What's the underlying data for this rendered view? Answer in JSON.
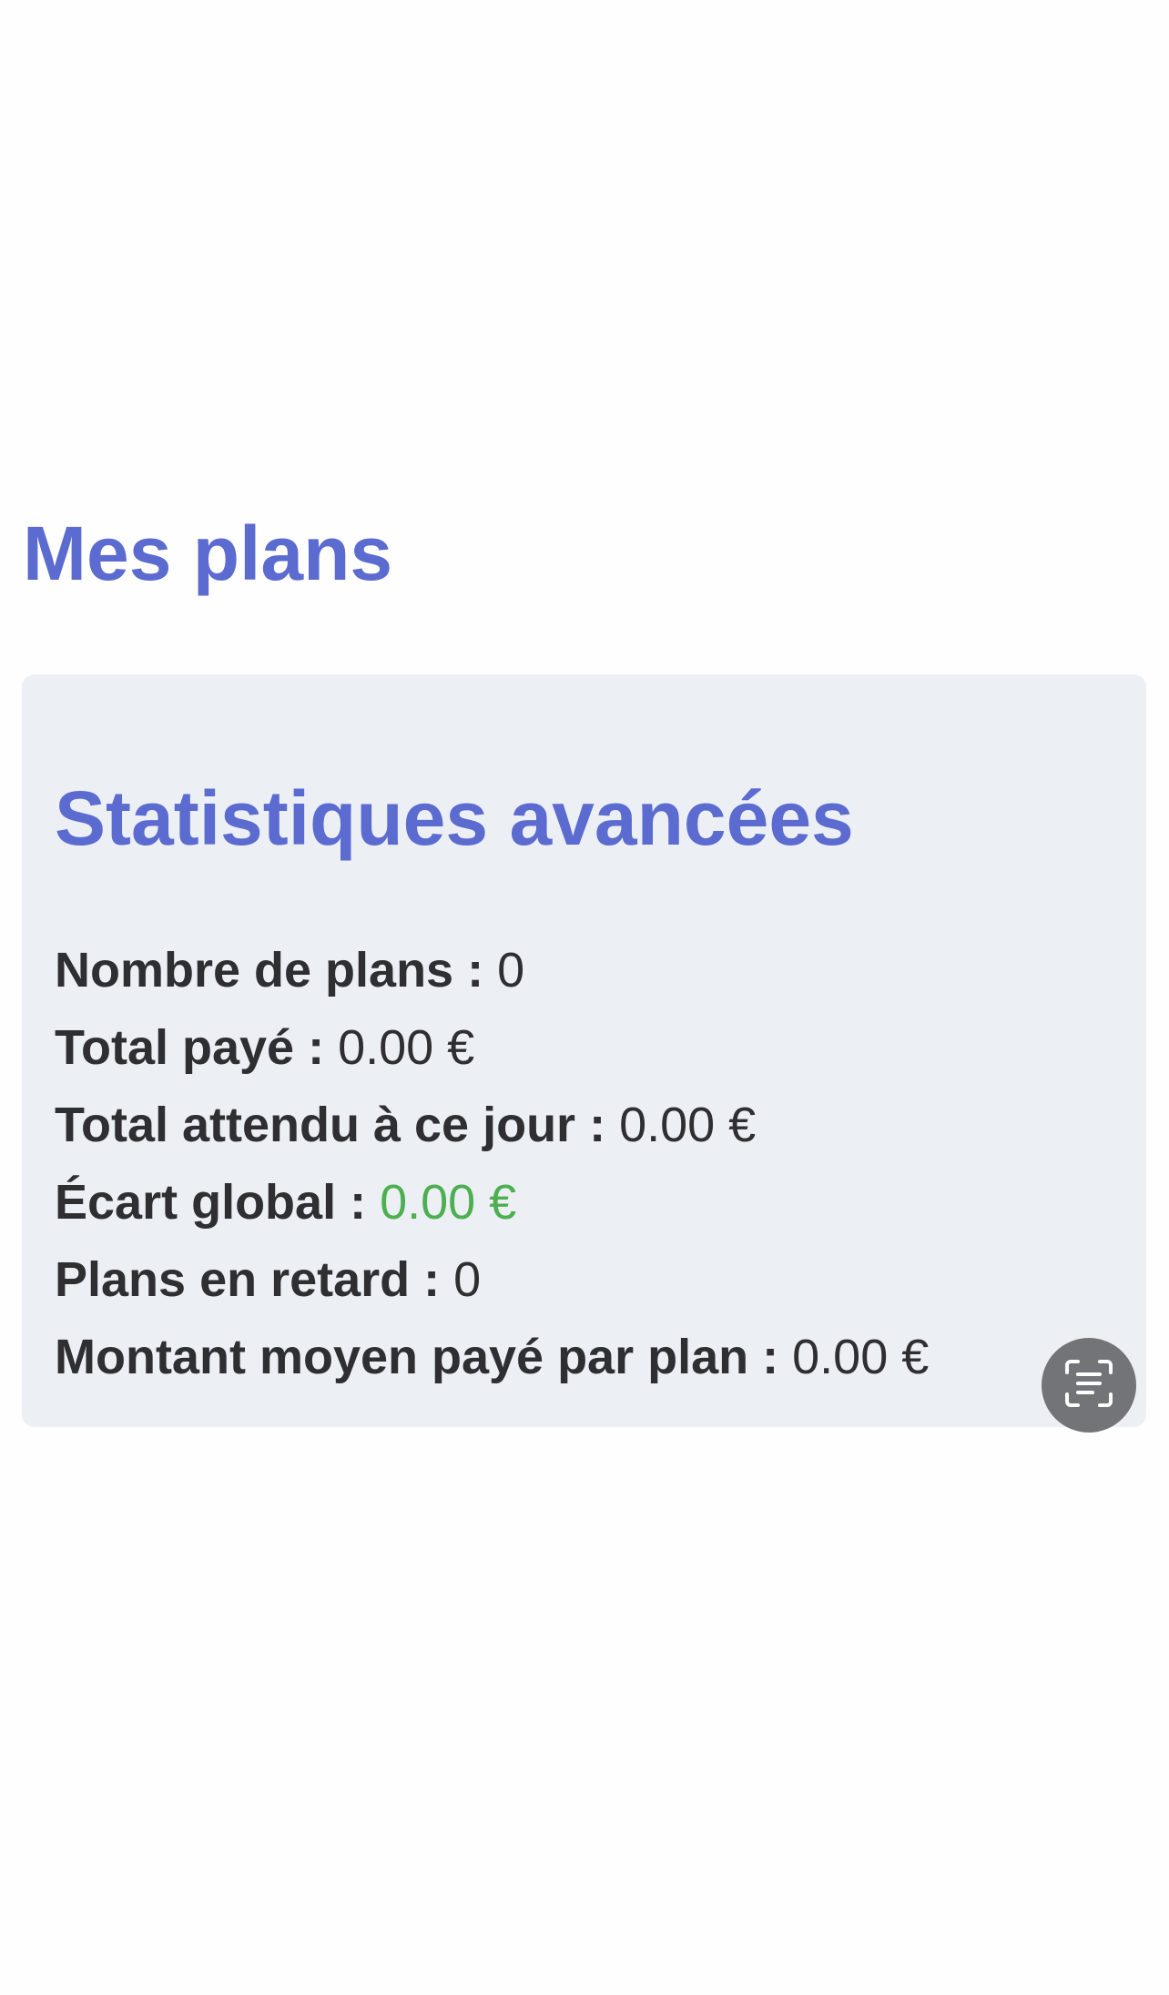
{
  "page": {
    "title": "Mes plans"
  },
  "stats": {
    "heading": "Statistiques avancées",
    "separator": " : ",
    "rows": [
      {
        "label": "Nombre de plans",
        "value": "0"
      },
      {
        "label": "Total payé",
        "value": "0.00 €"
      },
      {
        "label": "Total attendu à ce jour",
        "value": "0.00 €"
      },
      {
        "label": "Écart global",
        "value": "0.00 €",
        "value_color": "#4caf50"
      },
      {
        "label": "Plans en retard",
        "value": "0"
      },
      {
        "label": "Montant moyen payé par plan",
        "value": "0.00 €"
      }
    ]
  },
  "overlay": {
    "scan_button_icon": "live-text-scan-icon"
  },
  "colors": {
    "accent": "#5c6bd0",
    "card_background": "#eceff4",
    "text": "#2d2f33",
    "positive": "#4caf50",
    "overlay_button": "#737477"
  }
}
